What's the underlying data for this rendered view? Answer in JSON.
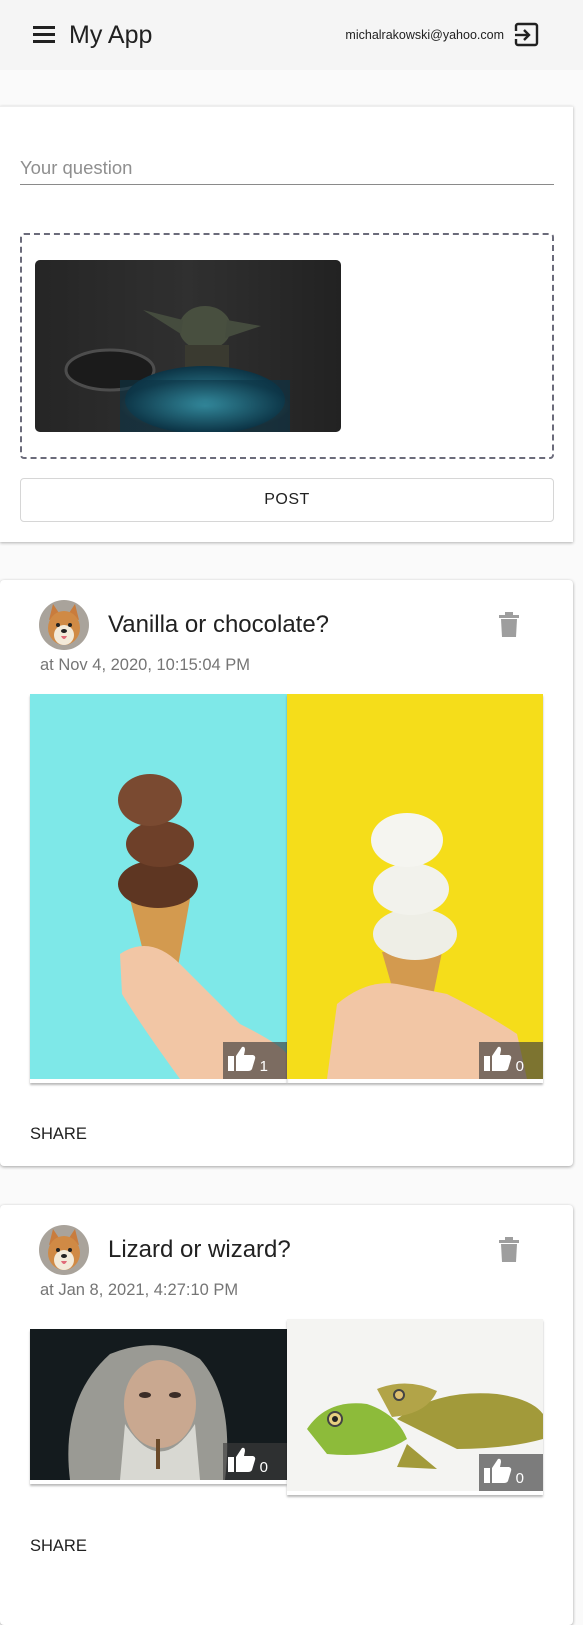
{
  "app": {
    "title": "My App",
    "user_email": "michalrakowski@yahoo.com"
  },
  "composer": {
    "question_placeholder": "Your question",
    "question_value": "",
    "post_label": "POST"
  },
  "posts": [
    {
      "title": "Vanilla or chocolate?",
      "timestamp": "at Nov 4, 2020, 10:15:04 PM",
      "share_label": "SHARE",
      "options": [
        {
          "image": "chocolate-ice-cream-cone",
          "votes": "1",
          "bg_color": "#7ee8e8"
        },
        {
          "image": "vanilla-ice-cream-cone",
          "votes": "0",
          "bg_color": "#f5dd1a"
        }
      ]
    },
    {
      "title": "Lizard or wizard?",
      "timestamp": "at Jan 8, 2021, 4:27:10 PM",
      "share_label": "SHARE",
      "options": [
        {
          "image": "wizard-photo",
          "votes": "0"
        },
        {
          "image": "lizard-photo",
          "votes": "0"
        }
      ]
    }
  ],
  "icons": {
    "menu": "menu-icon",
    "logout": "logout-icon",
    "delete": "trash-icon",
    "vote": "thumb-up-icon"
  },
  "colors": {
    "appbar_bg": "#f5f5f5",
    "dropzone_border": "#6b6b7a",
    "vote_overlay": "#3c3c3c",
    "icon_grey": "#9e9e9e"
  }
}
